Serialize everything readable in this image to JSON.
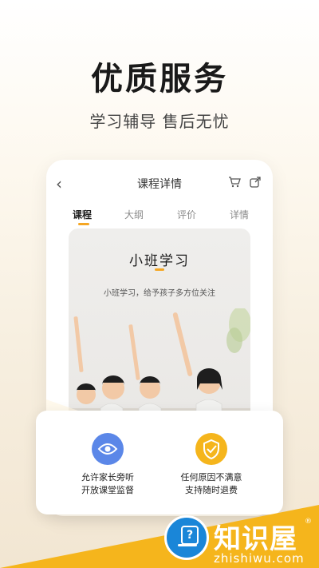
{
  "hero": {
    "title": "优质服务",
    "subtitle": "学习辅导 售后无忧"
  },
  "phone": {
    "back_icon": "chevron-left-icon",
    "title": "课程详情",
    "action_icons": [
      "cart-icon",
      "share-icon"
    ],
    "tabs": [
      {
        "label": "课程",
        "active": true
      },
      {
        "label": "大纲",
        "active": false
      },
      {
        "label": "评价",
        "active": false
      },
      {
        "label": "详情",
        "active": false
      }
    ],
    "card": {
      "title": "小班学习",
      "subtitle": "小班学习，给予孩子多方位关注"
    }
  },
  "features": [
    {
      "icon": "eye-icon",
      "color": "#5b87e8",
      "line1": "允许家长旁听",
      "line2": "开放课堂监督"
    },
    {
      "icon": "shield-check-icon",
      "color": "#f5b51c",
      "line1": "任何原因不满意",
      "line2": "支持随时退费"
    }
  ],
  "colors": {
    "accent": "#f5a623",
    "brand_yellow": "#f5b51c",
    "watermark_blue": "#1a86d8"
  },
  "watermark": {
    "icon": "computer-help-icon",
    "name": "知识屋",
    "reg": "®",
    "domain": "zhishiwu.com"
  }
}
